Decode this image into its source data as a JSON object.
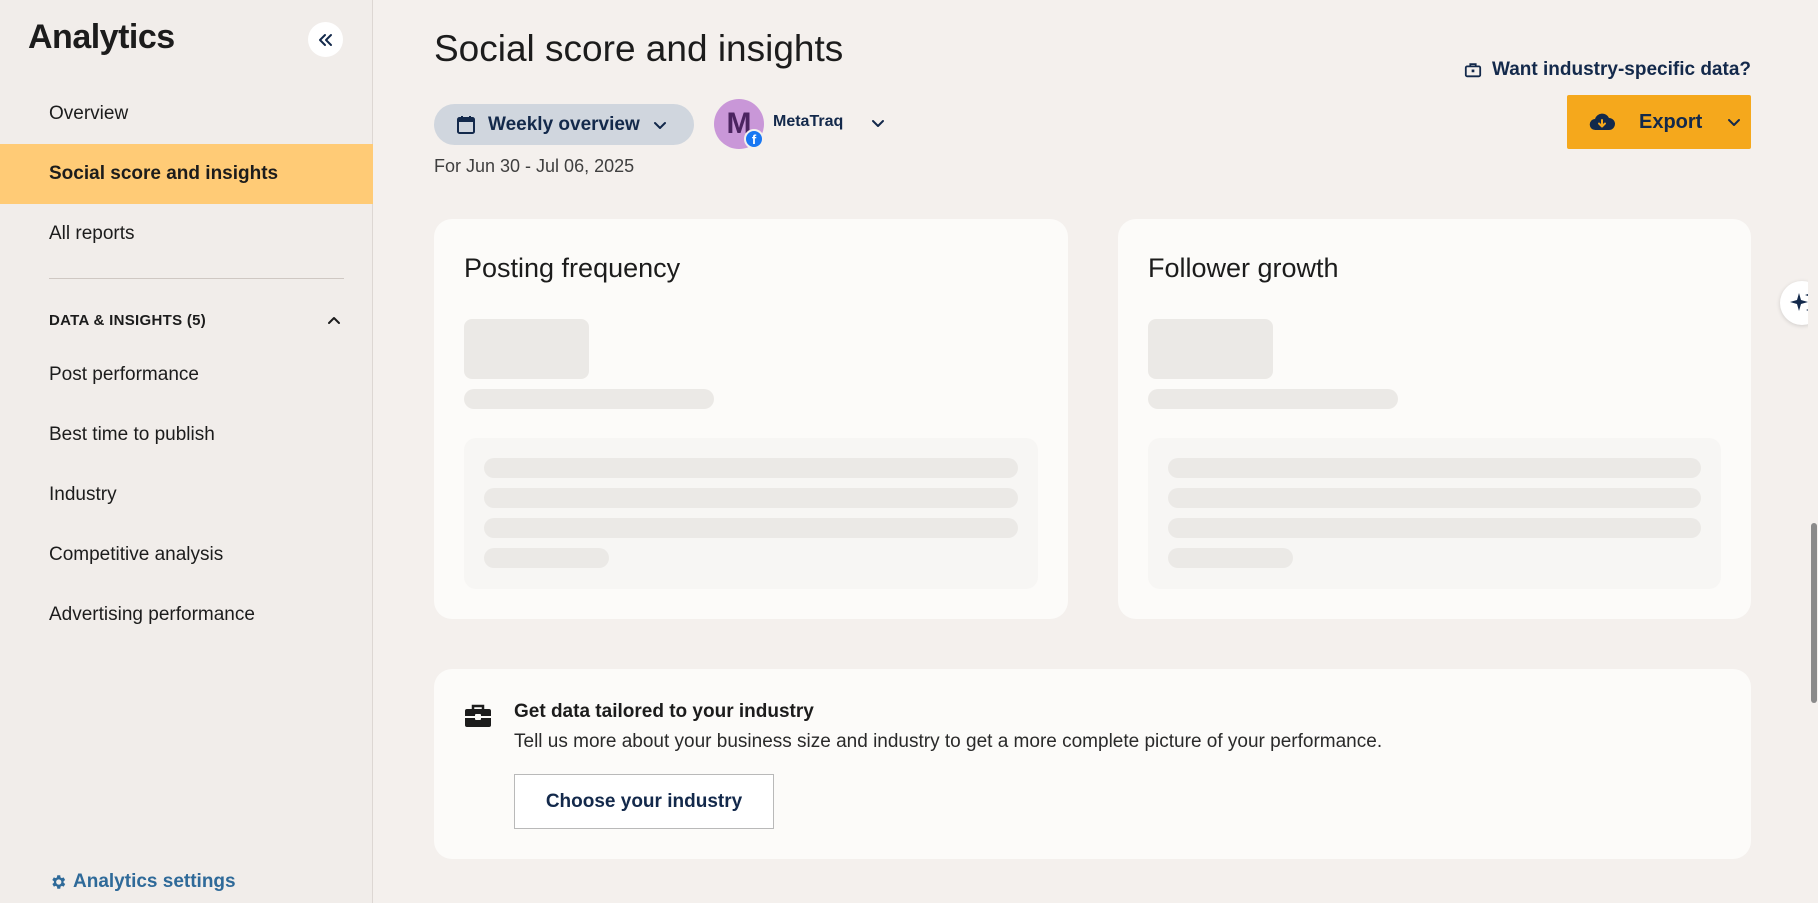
{
  "sidebar": {
    "title": "Analytics",
    "items": [
      {
        "label": "Overview"
      },
      {
        "label": "Social score and insights"
      },
      {
        "label": "All reports"
      }
    ],
    "section": {
      "label": "DATA & INSIGHTS (5)",
      "items": [
        {
          "label": "Post performance"
        },
        {
          "label": "Best time to publish"
        },
        {
          "label": "Industry"
        },
        {
          "label": "Competitive analysis"
        },
        {
          "label": "Advertising performance"
        }
      ]
    },
    "settings_label": "Analytics settings"
  },
  "header": {
    "title": "Social score and insights",
    "period_label": "Weekly overview",
    "profile_initial": "M",
    "profile_name": "MetaTraq",
    "date_range": "For Jun 30 - Jul 06, 2025",
    "industry_link": "Want industry-specific data?",
    "export_label": "Export"
  },
  "cards": {
    "posting_title": "Posting frequency",
    "follower_title": "Follower growth"
  },
  "banner": {
    "heading": "Get data tailored to your industry",
    "text": "Tell us more about your business size and industry to get a more complete picture of your performance.",
    "button": "Choose your industry"
  },
  "colors": {
    "accent": "#ffcb76",
    "export": "#f5a81c",
    "navy": "#13294b",
    "link": "#2f6a99"
  },
  "icons": [
    "double-chevron-left-icon",
    "chevron-up-icon",
    "calendar-icon",
    "chevron-down-icon",
    "facebook-icon",
    "briefcase-icon",
    "cloud-download-icon",
    "sparkle-icon",
    "gear-icon"
  ]
}
